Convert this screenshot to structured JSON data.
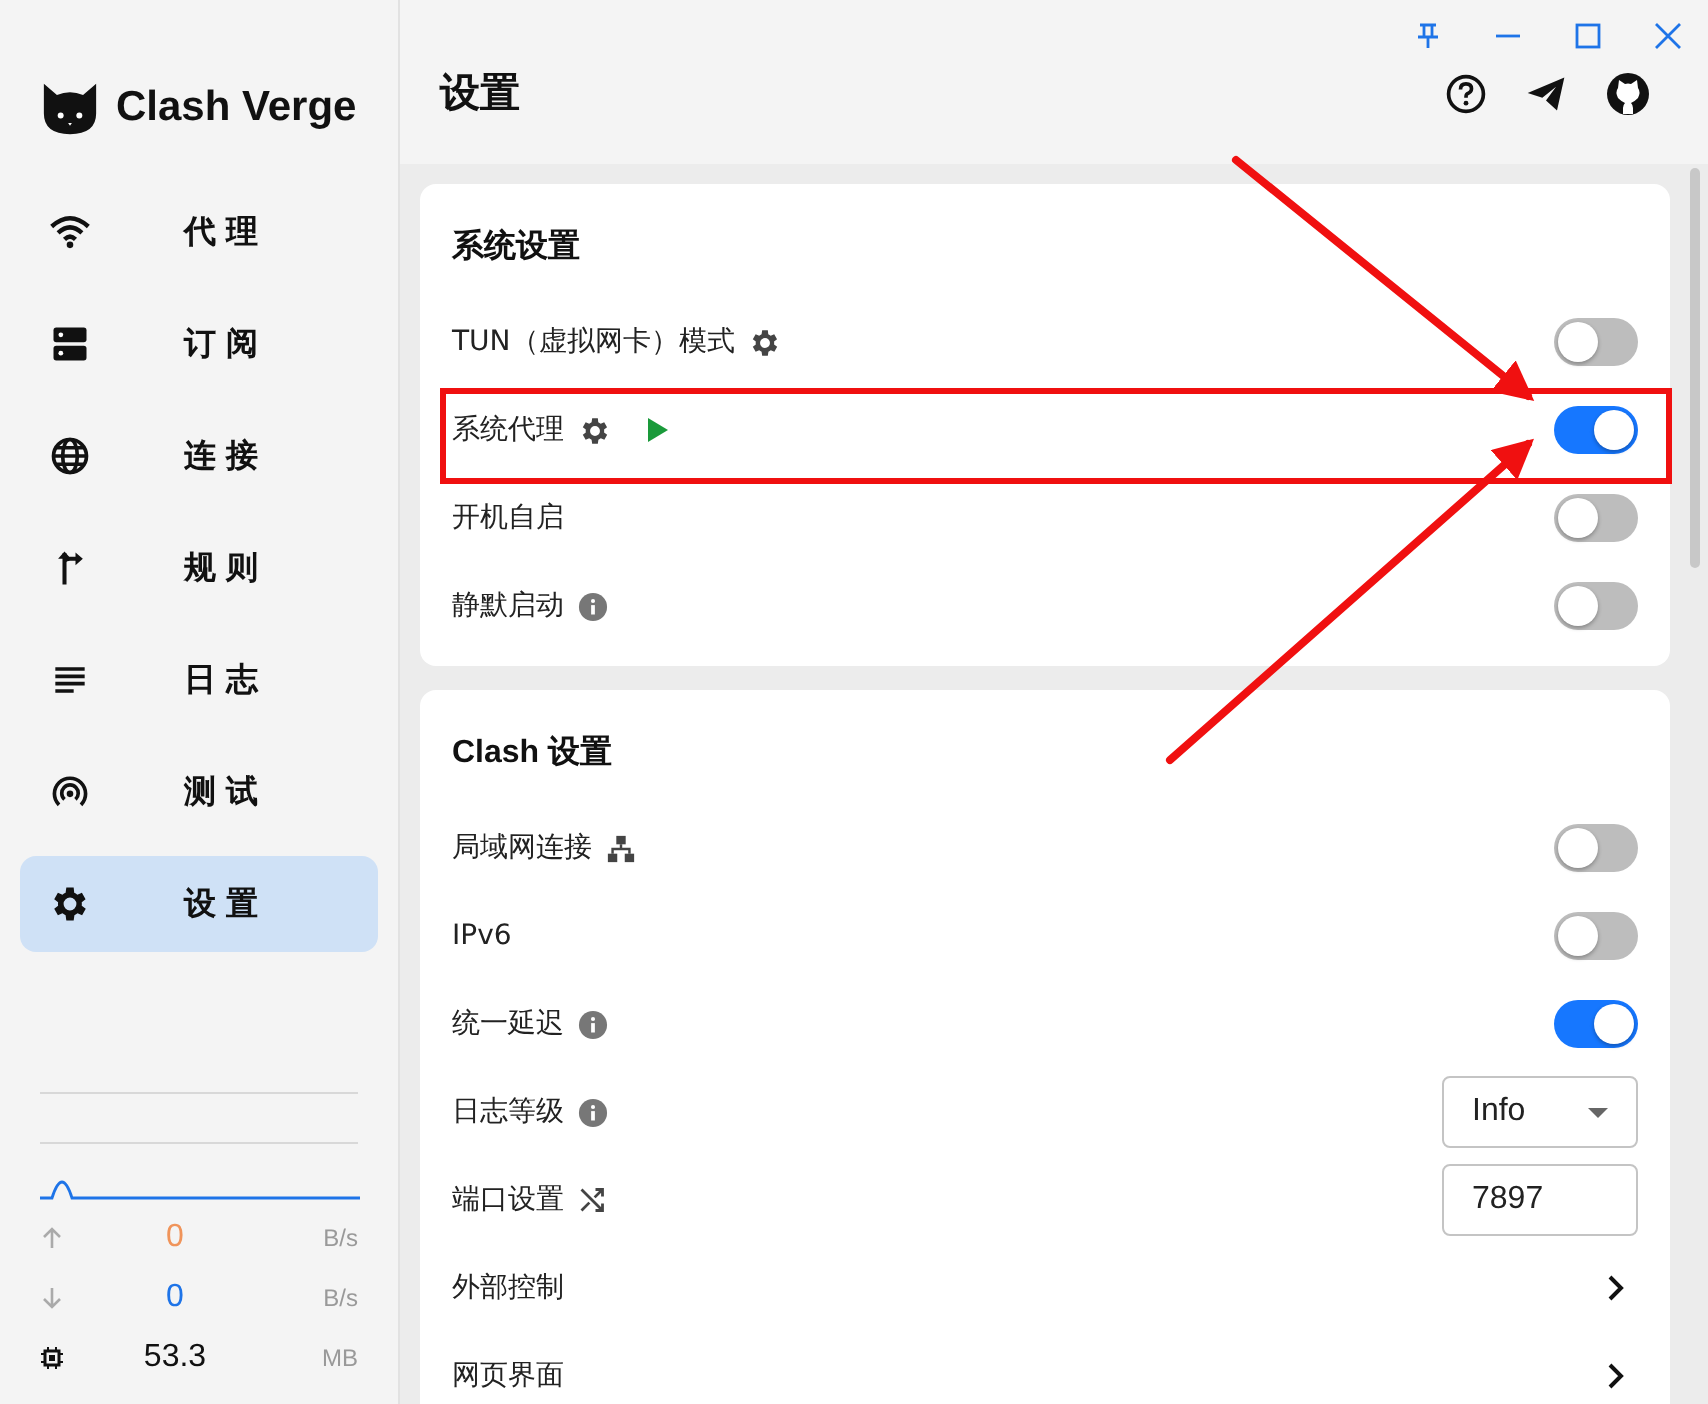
{
  "app": {
    "name": "Clash Verge"
  },
  "sidebar": {
    "items": [
      {
        "label": "代理",
        "selected": false
      },
      {
        "label": "订阅",
        "selected": false
      },
      {
        "label": "连接",
        "selected": false
      },
      {
        "label": "规则",
        "selected": false
      },
      {
        "label": "日志",
        "selected": false
      },
      {
        "label": "测试",
        "selected": false
      },
      {
        "label": "设置",
        "selected": true
      }
    ]
  },
  "traffic": {
    "upload": {
      "value": "0",
      "unit": "B/s"
    },
    "download": {
      "value": "0",
      "unit": "B/s"
    },
    "memory": {
      "value": "53.3",
      "unit": "MB"
    }
  },
  "page": {
    "title": "设置"
  },
  "sections": [
    {
      "title": "系统设置",
      "rows": [
        {
          "label": "TUN（虚拟网卡）模式",
          "kind": "toggle",
          "on": false
        },
        {
          "label": "系统代理",
          "kind": "toggle",
          "on": true
        },
        {
          "label": "开机自启",
          "kind": "toggle",
          "on": false
        },
        {
          "label": "静默启动",
          "kind": "toggle",
          "on": false
        }
      ]
    },
    {
      "title": "Clash 设置",
      "rows": [
        {
          "label": "局域网连接",
          "kind": "toggle",
          "on": false
        },
        {
          "label": "IPv6",
          "kind": "toggle",
          "on": false
        },
        {
          "label": "统一延迟",
          "kind": "toggle",
          "on": true
        },
        {
          "label": "日志等级",
          "kind": "select",
          "value": "Info"
        },
        {
          "label": "端口设置",
          "kind": "input",
          "value": "7897"
        },
        {
          "label": "外部控制",
          "kind": "link"
        },
        {
          "label": "网页界面",
          "kind": "link"
        }
      ]
    }
  ]
}
